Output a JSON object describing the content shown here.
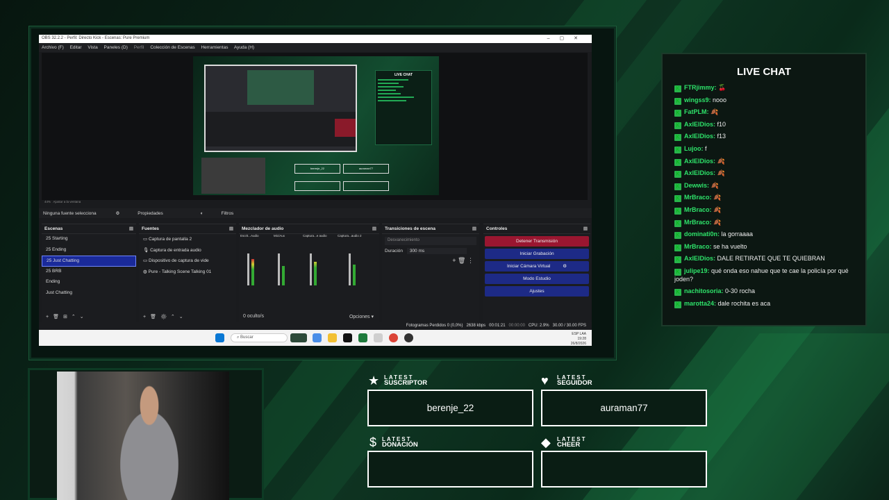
{
  "obs": {
    "title": "OBS 32.2.2 - Perfil: Directo Kick - Escenas: Pure Premium",
    "window_controls": [
      "–",
      "▢",
      "✕"
    ],
    "menu": [
      "Archivo (F)",
      "Editar",
      "Vista",
      "Paneles (D)",
      "Perfil",
      "Colección de Escenas",
      "Herramientas",
      "Ayuda (H)"
    ],
    "zoom_text": "44%",
    "zoom_fit": "Ajustar a la ventana",
    "no_source": "Ninguna fuente selecciona",
    "properties": "Propiedades",
    "filters": "Filtros",
    "scenes_title": "Escenas",
    "scenes": [
      "25 Starting",
      "25 Ending",
      "25 Just Chatting",
      "25 BRB",
      "Ending",
      "Just Chatting"
    ],
    "selected_scene": 2,
    "sources_title": "Fuentes",
    "sources": [
      "Captura de pantalla 2",
      "Captura de entrada audio",
      "Dispositivo de captura de vide",
      "Pure - Talking Scene Talking 01"
    ],
    "mixer_title": "Mezclador de audio",
    "mixer_channels": [
      "Escrit...Audio",
      "Mic/Aux",
      "Captura...e audio",
      "Captura...audio 2"
    ],
    "mixer_hidden": "0 oculto/s",
    "options": "Opciones",
    "transitions_title": "Transiciones de escena",
    "transition": "Desvanecimiento",
    "duration_label": "Duración",
    "duration_value": "300 ms",
    "controls_title": "Controles",
    "controls": {
      "stop_stream": "Detener Transmisión",
      "start_rec": "Iniciar Grabación",
      "virtual_cam": "Iniciar Cámara Virtual",
      "studio": "Modo Estudio",
      "settings": "Ajustes"
    },
    "status": {
      "dropped": "Fotogramas Perdidos 0 (0,0%)",
      "bitrate": "2638 kbps",
      "live_time": "00:01:21",
      "rec_time": "00:00:00",
      "cpu": "CPU: 2.9%",
      "fps": "30.00 / 30.00 FPS"
    },
    "taskbar": {
      "search": "Buscar",
      "lang": "ESP LAA",
      "time": "19:28",
      "date": "26/8/2026"
    }
  },
  "chat": {
    "title": "LIVE CHAT",
    "messages": [
      {
        "user": "FTRjimmy:",
        "text": "🍒"
      },
      {
        "user": "wingss9:",
        "text": "nooo"
      },
      {
        "user": "FatPLM:",
        "text": "🍂"
      },
      {
        "user": "AxlElDios:",
        "text": "f10"
      },
      {
        "user": "AxlElDios:",
        "text": "f13"
      },
      {
        "user": "Lujoo:",
        "text": "f"
      },
      {
        "user": "AxlElDios:",
        "text": "🍂"
      },
      {
        "user": "AxlElDios:",
        "text": "🍂"
      },
      {
        "user": "Dewwis:",
        "text": "🍂"
      },
      {
        "user": "MrBraco:",
        "text": "🍂"
      },
      {
        "user": "MrBraco:",
        "text": "🍂"
      },
      {
        "user": "MrBraco:",
        "text": "🍂"
      },
      {
        "user": "dominati0n:",
        "text": "la gorraaaa"
      },
      {
        "user": "MrBraco:",
        "text": "se ha vuelto"
      },
      {
        "user": "AxlElDios:",
        "text": "DALE RETIRATE QUE TE QUIEBRAN"
      },
      {
        "user": "julipe19:",
        "text": "qué onda eso nahue que te cae la policía por qué joden?"
      },
      {
        "user": "nachitosoria:",
        "text": "0-30 rocha"
      },
      {
        "user": "marotta24:",
        "text": "dale rochita es aca"
      }
    ]
  },
  "latest": {
    "label_top": "LATEST",
    "suscriptor_label": "SUSCRIPTOR",
    "suscriptor_value": "berenje_22",
    "seguidor_label": "SEGUIDOR",
    "seguidor_value": "auraman77",
    "donacion_label": "DONACIÓN",
    "donacion_value": "",
    "cheer_label": "CHEER",
    "cheer_value": ""
  },
  "icons": {
    "star": "star-icon",
    "heart": "heart-icon",
    "dollar": "dollar-icon",
    "diamond": "diamond-icon"
  },
  "colors": {
    "accent_green": "#2ee36a",
    "stop_button": "#9a1630",
    "control_button": "#1d2a86",
    "selected_scene": "#1a2a9a"
  }
}
